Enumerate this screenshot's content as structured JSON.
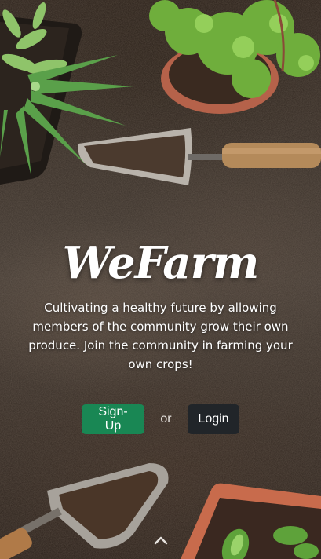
{
  "brand": {
    "name": "WeFarm",
    "tagline": "Cultivating a healthy future by allowing members of the community grow their own produce. Join the community in farming your own crops!"
  },
  "actions": {
    "signup_label": "Sign-Up",
    "separator": "or",
    "login_label": "Login"
  },
  "colors": {
    "signup": "#198754",
    "login": "#212529",
    "text": "#ffffff"
  },
  "icons": {
    "scroll": "chevron-up-icon"
  }
}
